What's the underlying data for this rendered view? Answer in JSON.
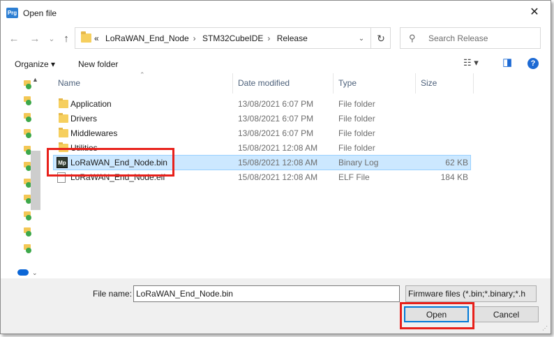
{
  "window": {
    "app_icon_text": "Prg",
    "title": "Open file",
    "close_glyph": "✕"
  },
  "nav": {
    "back_glyph": "←",
    "forward_glyph": "→",
    "recent_glyph": "⌄",
    "up_glyph": "↑",
    "breadcrumb": [
      "«",
      "LoRaWAN_End_Node",
      "STM32CubeIDE",
      "Release"
    ],
    "dropdown_glyph": "⌄",
    "refresh_glyph": "↻",
    "search_placeholder": "Search Release",
    "search_glyph": "⚲"
  },
  "toolbar": {
    "organize_label": "Organize ▾",
    "new_folder_label": "New folder",
    "view_glyph": "☷ ▾",
    "preview_glyph": "◨",
    "help_glyph": "?"
  },
  "columns": [
    "Name",
    "Date modified",
    "Type",
    "Size"
  ],
  "files": [
    {
      "name": "Application",
      "date": "13/08/2021 6:07 PM",
      "type": "File folder",
      "size": "",
      "icon": "folder-icon",
      "selected": false
    },
    {
      "name": "Drivers",
      "date": "13/08/2021 6:07 PM",
      "type": "File folder",
      "size": "",
      "icon": "folder-icon",
      "selected": false
    },
    {
      "name": "Middlewares",
      "date": "13/08/2021 6:07 PM",
      "type": "File folder",
      "size": "",
      "icon": "folder-icon",
      "selected": false
    },
    {
      "name": "Utilities",
      "date": "15/08/2021 12:08 AM",
      "type": "File folder",
      "size": "",
      "icon": "folder-icon",
      "selected": false
    },
    {
      "name": "LoRaWAN_End_Node.bin",
      "date": "15/08/2021 12:08 AM",
      "type": "Binary Log",
      "size": "62 KB",
      "icon": "binary-file-icon",
      "selected": true
    },
    {
      "name": "LoRaWAN_End_Node.elf",
      "date": "15/08/2021 12:08 AM",
      "type": "ELF File",
      "size": "184 KB",
      "icon": "elf-file-icon",
      "selected": false
    }
  ],
  "bottom": {
    "file_name_label": "File name:",
    "file_name_value": "LoRaWAN_End_Node.bin",
    "filter_value": "Firmware files (*.bin;*.binary;*.h",
    "open_label": "Open",
    "cancel_label": "Cancel"
  },
  "colors": {
    "highlight": "#e8201a",
    "selection": "#cce8ff",
    "accent": "#0078d7"
  }
}
